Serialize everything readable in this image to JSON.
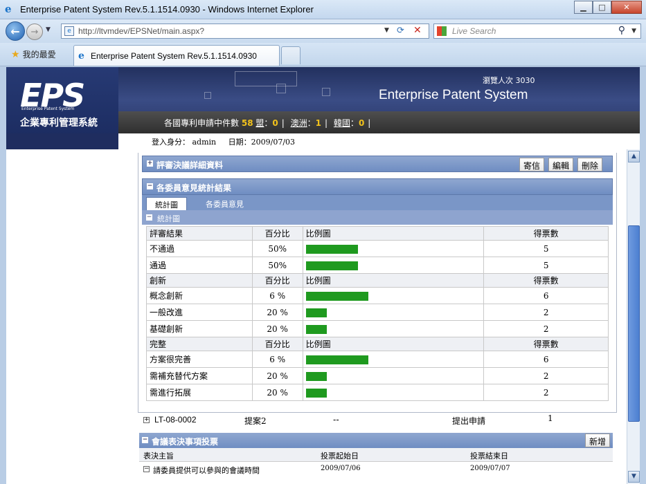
{
  "window": {
    "title": "Enterprise Patent System Rev.5.1.1514.0930 - Windows Internet Explorer",
    "minimize": "▁",
    "maximize": "□",
    "close": "✕"
  },
  "address": {
    "url": "http://ltvmdev/EPSNet/main.aspx?",
    "search_placeholder": "Live Search"
  },
  "tabs": {
    "favorites": "我的最愛",
    "active_tab": "Enterprise Patent System Rev.5.1.1514.0930"
  },
  "banner": {
    "logo": "EPS",
    "logo_sub": "Enterprise Patent System",
    "logo_cn": "企業專利管理系統",
    "visits": "瀏覽人次 3030",
    "system_name": "Enterprise Patent System",
    "stats_label": "各國專利申請中件數",
    "stats_total": "58",
    "stats_items": [
      {
        "label": "盟",
        "value": "0"
      },
      {
        "label": "澳洲",
        "value": "1"
      },
      {
        "label": "韓國",
        "value": "0"
      }
    ],
    "login_label": "登入身分：",
    "login_user": "admin",
    "date_label": "日期：",
    "date_value": "2009/07/03"
  },
  "review": {
    "title": "評審決議詳細資料",
    "buttons": {
      "mail": "寄信",
      "edit": "編輯",
      "delete": "刪除"
    }
  },
  "committee": {
    "title": "各委員意見統計結果",
    "tabs": {
      "chart": "統計圖",
      "opinions": "各委員意見"
    },
    "chart_title": "統計圖"
  },
  "stats_table": {
    "groups": [
      {
        "headers": [
          "評審結果",
          "百分比",
          "比例圖",
          "得票數"
        ],
        "rows": [
          {
            "label": "不通過",
            "pct": "50%",
            "votes": "5",
            "frac": 0.5
          },
          {
            "label": "通過",
            "pct": "50%",
            "votes": "5",
            "frac": 0.5
          }
        ]
      },
      {
        "headers": [
          "創新",
          "百分比",
          "比例圖",
          "得票數"
        ],
        "rows": [
          {
            "label": "概念創新",
            "pct": "6 %",
            "votes": "6",
            "frac": 0.6
          },
          {
            "label": "一般改進",
            "pct": "20 %",
            "votes": "2",
            "frac": 0.2
          },
          {
            "label": "基礎創新",
            "pct": "20 %",
            "votes": "2",
            "frac": 0.2
          }
        ]
      },
      {
        "headers": [
          "完整",
          "百分比",
          "比例圖",
          "得票數"
        ],
        "rows": [
          {
            "label": "方案很完善",
            "pct": "6 %",
            "votes": "6",
            "frac": 0.6
          },
          {
            "label": "需補充替代方案",
            "pct": "20 %",
            "votes": "2",
            "frac": 0.2
          },
          {
            "label": "需進行拓展",
            "pct": "20 %",
            "votes": "2",
            "frac": 0.2
          }
        ]
      }
    ]
  },
  "proposal": {
    "id": "LT-08-0002",
    "name": "提案2",
    "dash": "--",
    "status": "提出申請",
    "count": "1"
  },
  "vote": {
    "title": "會議表決事項投票",
    "add_button": "新增",
    "columns": [
      "表決主旨",
      "投票起始日",
      "投票結束日"
    ],
    "row": {
      "subject": "請委員提供可以參與的會議時間",
      "start": "2009/07/06",
      "end": "2009/07/07"
    }
  },
  "colors": {
    "bar": "#1f9a1f",
    "header_blue": "#7a96c7",
    "stat_num": "#f2c21b"
  }
}
